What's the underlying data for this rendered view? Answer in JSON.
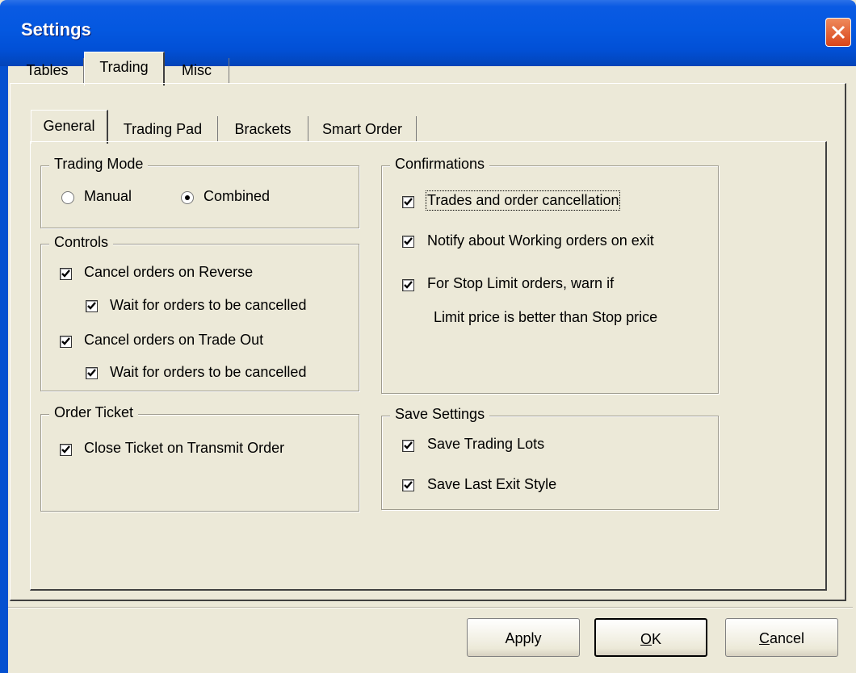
{
  "window": {
    "title": "Settings"
  },
  "outer_tabs": [
    {
      "label": "Tables"
    },
    {
      "label": "Trading",
      "active": true
    },
    {
      "label": "Misc"
    }
  ],
  "inner_tabs": [
    {
      "label": "General",
      "active": true
    },
    {
      "label": "Trading Pad"
    },
    {
      "label": "Brackets"
    },
    {
      "label": "Smart Order"
    }
  ],
  "trading_mode": {
    "title": "Trading Mode",
    "options": [
      {
        "label": "Manual",
        "selected": false
      },
      {
        "label": "Combined",
        "selected": true
      }
    ]
  },
  "controls": {
    "title": "Controls",
    "items": [
      {
        "label": "Cancel orders on Reverse",
        "checked": true
      },
      {
        "label": "Wait for orders to be cancelled",
        "checked": true
      },
      {
        "label": "Cancel orders on Trade Out",
        "checked": true
      },
      {
        "label": "Wait for orders to be cancelled",
        "checked": true
      }
    ]
  },
  "order_ticket": {
    "title": "Order Ticket",
    "items": [
      {
        "label": "Close Ticket on Transmit Order",
        "checked": true
      }
    ]
  },
  "confirmations": {
    "title": "Confirmations",
    "items": [
      {
        "label": "Trades and order cancellation",
        "checked": true
      },
      {
        "label": "Notify about Working orders on exit",
        "checked": true
      },
      {
        "label": "For Stop Limit orders, warn if",
        "checked": true
      }
    ],
    "continuation": "Limit price is better than Stop price"
  },
  "save_settings": {
    "title": "Save Settings",
    "items": [
      {
        "label": "Save Trading Lots",
        "checked": true
      },
      {
        "label": "Save Last Exit Style",
        "checked": true
      }
    ]
  },
  "buttons": {
    "apply": "Apply",
    "ok_underlined": "O",
    "ok_rest": "K",
    "cancel_underlined": "C",
    "cancel_rest": "ancel"
  }
}
